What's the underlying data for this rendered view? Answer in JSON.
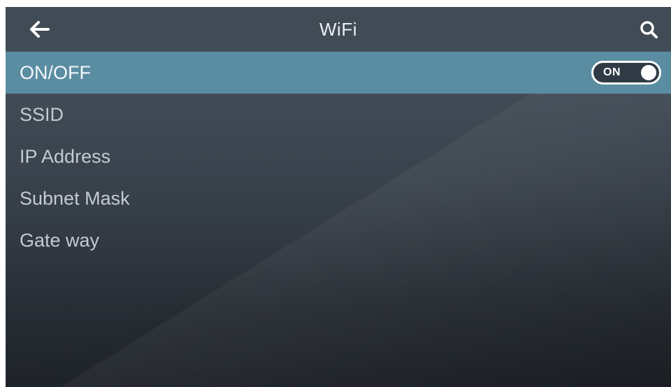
{
  "header": {
    "title": "WiFi",
    "back_icon": "arrow-left-icon",
    "search_icon": "search-icon"
  },
  "menu": {
    "items": [
      {
        "label": "ON/OFF",
        "active": true,
        "control": "toggle"
      },
      {
        "label": "SSID"
      },
      {
        "label": "IP Address"
      },
      {
        "label": "Subnet Mask"
      },
      {
        "label": "Gate way"
      }
    ]
  },
  "toggle": {
    "state_label": "ON",
    "on": true
  },
  "colors": {
    "active_row": "#5b8da2",
    "header_bg": "#414b55",
    "text": "#c3cbd2"
  }
}
